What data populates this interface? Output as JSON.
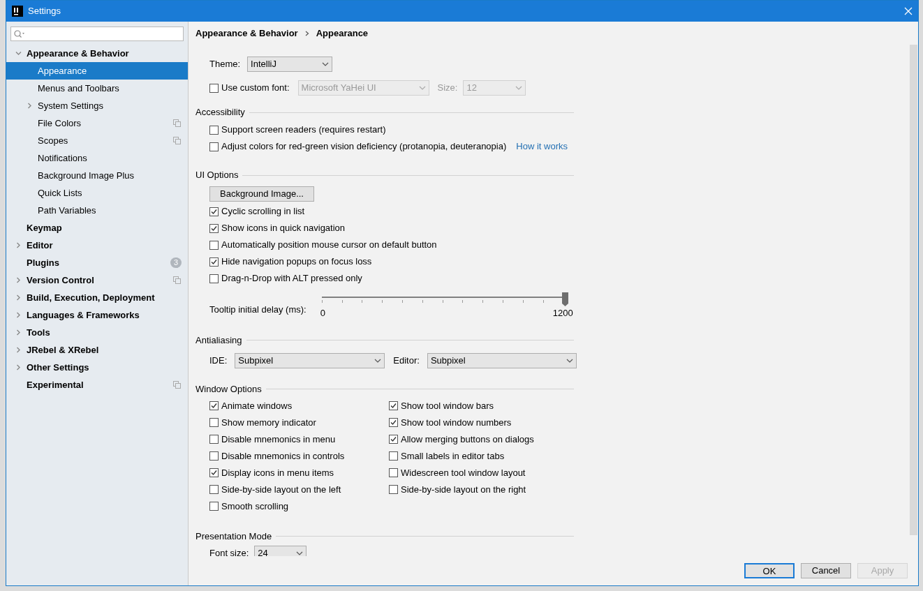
{
  "window": {
    "title": "Settings"
  },
  "sidebar": {
    "items": [
      {
        "label": "Appearance & Behavior",
        "kind": "expandable",
        "expanded": true,
        "selected": false,
        "scoped": false,
        "children": [
          {
            "label": "Appearance",
            "kind": "leaf",
            "selected": true,
            "scoped": false
          },
          {
            "label": "Menus and Toolbars",
            "kind": "leaf",
            "selected": false,
            "scoped": false
          },
          {
            "label": "System Settings",
            "kind": "expandable",
            "expanded": false,
            "selected": false,
            "scoped": false
          },
          {
            "label": "File Colors",
            "kind": "leaf",
            "selected": false,
            "scoped": true
          },
          {
            "label": "Scopes",
            "kind": "leaf",
            "selected": false,
            "scoped": true
          },
          {
            "label": "Notifications",
            "kind": "leaf",
            "selected": false,
            "scoped": false
          },
          {
            "label": "Background Image Plus",
            "kind": "leaf",
            "selected": false,
            "scoped": false
          },
          {
            "label": "Quick Lists",
            "kind": "leaf",
            "selected": false,
            "scoped": false
          },
          {
            "label": "Path Variables",
            "kind": "leaf",
            "selected": false,
            "scoped": false
          }
        ]
      },
      {
        "label": "Keymap",
        "kind": "leaf",
        "selected": false,
        "scoped": false
      },
      {
        "label": "Editor",
        "kind": "expandable",
        "expanded": false,
        "selected": false,
        "scoped": false
      },
      {
        "label": "Plugins",
        "kind": "leaf",
        "selected": false,
        "scoped": false,
        "badge": "3"
      },
      {
        "label": "Version Control",
        "kind": "expandable",
        "expanded": false,
        "selected": false,
        "scoped": true
      },
      {
        "label": "Build, Execution, Deployment",
        "kind": "expandable",
        "expanded": false,
        "selected": false,
        "scoped": false
      },
      {
        "label": "Languages & Frameworks",
        "kind": "expandable",
        "expanded": false,
        "selected": false,
        "scoped": false
      },
      {
        "label": "Tools",
        "kind": "expandable",
        "expanded": false,
        "selected": false,
        "scoped": false
      },
      {
        "label": "JRebel & XRebel",
        "kind": "expandable",
        "expanded": false,
        "selected": false,
        "scoped": false
      },
      {
        "label": "Other Settings",
        "kind": "expandable",
        "expanded": false,
        "selected": false,
        "scoped": false
      },
      {
        "label": "Experimental",
        "kind": "leaf",
        "selected": false,
        "scoped": true
      }
    ]
  },
  "breadcrumb": [
    "Appearance & Behavior",
    "Appearance"
  ],
  "theme": {
    "label": "Theme:",
    "value": "IntelliJ"
  },
  "custom_font": {
    "label": "Use custom font:",
    "checked": false,
    "font": "Microsoft YaHei UI",
    "size_label": "Size:",
    "size": "12",
    "disabled": true
  },
  "accessibility": {
    "title": "Accessibility",
    "options": [
      {
        "label": "Support screen readers (requires restart)",
        "checked": false
      },
      {
        "label": "Adjust colors for red-green vision deficiency (protanopia, deuteranopia)",
        "checked": false,
        "link": "How it works"
      }
    ]
  },
  "ui_options": {
    "title": "UI Options",
    "button": "Background Image...",
    "options": [
      {
        "label": "Cyclic scrolling in list",
        "checked": true
      },
      {
        "label": "Show icons in quick navigation",
        "checked": true
      },
      {
        "label": "Automatically position mouse cursor on default button",
        "checked": false
      },
      {
        "label": "Hide navigation popups on focus loss",
        "checked": true
      },
      {
        "label": "Drag-n-Drop with ALT pressed only",
        "checked": false
      }
    ],
    "tooltip_delay": {
      "label": "Tooltip initial delay (ms):",
      "level": 1,
      "min": "0",
      "max": "1200"
    }
  },
  "antialiasing": {
    "title": "Antialiasing",
    "ide": {
      "label": "IDE:",
      "value": "Subpixel"
    },
    "editor": {
      "label": "Editor:",
      "value": "Subpixel"
    }
  },
  "window_options": {
    "title": "Window Options",
    "rows": [
      [
        {
          "label": "Animate windows",
          "checked": true
        },
        {
          "label": "Show tool window bars",
          "checked": true
        }
      ],
      [
        {
          "label": "Show memory indicator",
          "checked": false
        },
        {
          "label": "Show tool window numbers",
          "checked": true
        }
      ],
      [
        {
          "label": "Disable mnemonics in menu",
          "checked": false
        },
        {
          "label": "Allow merging buttons on dialogs",
          "checked": true
        }
      ],
      [
        {
          "label": "Disable mnemonics in controls",
          "checked": false
        },
        {
          "label": "Small labels in editor tabs",
          "checked": false
        }
      ],
      [
        {
          "label": "Display icons in menu items",
          "checked": true
        },
        {
          "label": "Widescreen tool window layout",
          "checked": false
        }
      ],
      [
        {
          "label": "Side-by-side layout on the left",
          "checked": false
        },
        {
          "label": "Side-by-side layout on the right",
          "checked": false
        }
      ],
      [
        {
          "label": "Smooth scrolling",
          "checked": false
        }
      ]
    ]
  },
  "presentation_mode": {
    "title": "Presentation Mode",
    "font_size": {
      "label": "Font size:",
      "value": "24"
    }
  },
  "buttons": [
    {
      "label": "OK",
      "default": true,
      "disabled": false
    },
    {
      "label": "Cancel",
      "default": false,
      "disabled": false
    },
    {
      "label": "Apply",
      "default": false,
      "disabled": true
    }
  ]
}
